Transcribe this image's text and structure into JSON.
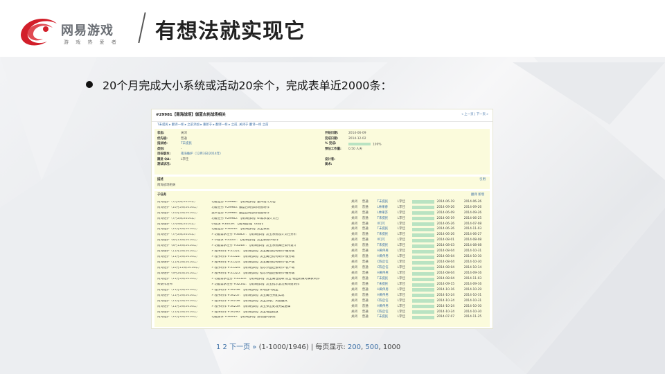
{
  "brand": {
    "name": "网易游戏",
    "sub": "游 戏 热 爱 者",
    "accent": "#d21f2a"
  },
  "slide": {
    "title": "有想法就实现它",
    "bullet": "20个月完成大小系统或活动20余个，完成表单近2000条："
  },
  "screenshot": {
    "title": "#29981【南海战场】伽蓝古刹战场相关",
    "nav": "« 上一页 | 下一页 »",
    "links": "T未提民 ▸ 翻译一样  ▸ 之前添加  ▸ 重新于 ▸ 翻译一样  ▸ 之前, 关闭于 翻译一样 之前",
    "attrs_left": [
      {
        "k": "状态:",
        "v": "关闭"
      },
      {
        "k": "优先级:",
        "v": "普通"
      },
      {
        "k": "指派给:",
        "v": "T未提民"
      },
      {
        "k": "类别:",
        "v": "-"
      },
      {
        "k": "目标版本:",
        "v": "南海维护（12月3日/2014年）"
      },
      {
        "k": "跟进 QA:",
        "v": "L李佳"
      },
      {
        "k": "测试状况:",
        "v": ""
      }
    ],
    "attrs_right": [
      {
        "k": "开始日期:",
        "v": "2014-06-09"
      },
      {
        "k": "完成日期:",
        "v": "2014-12-02"
      },
      {
        "k": "% 完成:",
        "v": "100%"
      },
      {
        "k": "预估工作量:",
        "v": "0.50 人天"
      },
      {
        "k": "",
        "v": ""
      },
      {
        "k": "设计者:",
        "v": ""
      },
      {
        "k": "美术:",
        "v": ""
      }
    ],
    "desc_label": "描述",
    "desc_value": "南海战场相关",
    "quote": "引用",
    "sub_label": "子任务",
    "sub_actions": "翻译  新增",
    "rows": [
      [
        "南海维护（7月2日/2014年）",
        "功能任务 #29982: 【南海战场】整体设计文档",
        "关闭",
        "普通",
        "T未提民",
        "L李佳",
        "2014-06-19",
        "2014-06-26"
      ],
      [
        "南海维护（10月5日/2014年）",
        "功能任务 #29983: 伽蓝古刹战场地图制作",
        "关闭",
        "普通",
        "L林果春",
        "L李佳",
        "2014-09-26",
        "2014-09-26"
      ],
      [
        "南海维护（10月5日/2014年）",
        "美术任务 #29984: 伽蓝古刹战场地图制作",
        "关闭",
        "普通",
        "L林果苏",
        "L李佳",
        "2014-06-09",
        "2014-09-26"
      ],
      [
        "南海维护（7月2日/2014年）",
        "功能任务 #29985: 【南海战场】UI需求设计文档",
        "关闭",
        "普通",
        "T未提民",
        "L李佳",
        "2014-06-19",
        "2014-06-25"
      ],
      [
        "南海维护（7月9日/2014年）",
        "UI需求 #30039: 【南海战场】UI制作",
        "关闭",
        "普通",
        "X叮叮",
        "L李佳",
        "2014-06-26",
        "2014-07-08"
      ],
      [
        "南海维护（12月3日/2014年）",
        "功能任务 #30040: 【南海战场】流宝系统",
        "关闭",
        "普通",
        "T未提民",
        "L李佳",
        "2014-06-26",
        "2014-11-03"
      ],
      [
        "南海维护（7月2日/2014年）",
        "» 功能需求任务 #30857: 【南海战场】流宝系统设计文档分析",
        "关闭",
        "普通",
        "T未提民",
        "L李佳",
        "2014-06-26",
        "2014-06-27"
      ],
      [
        "南海维护（8月13日/2014年）",
        "» UI需求 #31037: 【南海战场】流宝系统UI制作",
        "关闭",
        "普通",
        "X叮叮",
        "L李佳",
        "2014-08-01",
        "2014-08-08"
      ],
      [
        "南海维护（8月13日/2014年）",
        "» 功能需求任务 #31467: 【南海战场】流宝系统属性架构设计",
        "关闭",
        "普通",
        "T未提民",
        "L李佳",
        "2014-08-03",
        "2014-08-08"
      ],
      [
        "南海维护（11月5日/2014年）",
        "» 程序制作 #31521: 【南海战场】流宝属性结构制作-服务端",
        "关闭",
        "普通",
        "H黄伟男",
        "L李佳",
        "2014-08-04",
        "2014-10-31"
      ],
      [
        "南海维护（11月5日/2014年）",
        "» 程序制作 #31522: 【南海战场】流宝属性结构制作-服务端",
        "关闭",
        "普通",
        "H黄伟男",
        "L李佳",
        "2014-08-04",
        "2014-10-30"
      ],
      [
        "南海维护（11月5日/2014年）",
        "» 程序制作 #31523: 【南海战场】流宝属性结构制作-客户端",
        "关闭",
        "普通",
        "C陈启信",
        "L李佳",
        "2014-08-04",
        "2014-10-30"
      ],
      [
        "南海维护（10月15日/2014年）",
        "» 程序制作 #31524: 【南海战场】指示界面连接制作-客户端",
        "关闭",
        "普通",
        "C陈启信",
        "L李佳",
        "2014-08-04",
        "2014-10-14"
      ],
      [
        "南海维护（9月24日/2014年）",
        "» 程序制作 #31525: 【南海战场】指示界面连接制作-服务端",
        "关闭",
        "普通",
        "H黄伟男",
        "L李佳",
        "2014-08-04",
        "2014-09-16"
      ],
      [
        "南海维护（11月5日/2014年）",
        "» 功能需求任务 #31526: 【南海战场】流宝属性提取·流宝·物品附属对属表制作",
        "关闭",
        "普通",
        "T未提民",
        "L李佳",
        "2014-08-04",
        "2014-11-03"
      ],
      [
        "未安排发布",
        "» 功能需求任务 #32542: 【南海战场】流宝指示激活关闭组制作",
        "关闭",
        "普通",
        "T未提民",
        "L李佳",
        "2014-09-15",
        "2014-09-16"
      ],
      [
        "南海维护（11月5日/2014年）",
        "» 程序制作 #34258: 【南海战场】新增战斗类型",
        "关闭",
        "普通",
        "H黄伟男",
        "L李佳",
        "2014-10-16",
        "2014-10-29"
      ],
      [
        "南海维护（11月5日/2014年）",
        "» 程序制作 #34257: 【南海战场】流宝属性分配实现",
        "关闭",
        "普通",
        "H黄伟男",
        "L李佳",
        "2014-10-24",
        "2014-10-31"
      ],
      [
        "南海维护（11月5日/2014年）",
        "» 程序制作 #34258: 【南海战场】流宝分级，奖励器具",
        "关闭",
        "普通",
        "C陈启信",
        "L李佳",
        "2014-10-24",
        "2014-10-31"
      ],
      [
        "南海维护（11月5日/2014年）",
        "» 程序制作 #34259: 【南海战场】流宝弹出处理分类逻辑",
        "关闭",
        "普通",
        "H黄伟男",
        "L李佳",
        "2014-10-24",
        "2014-10-30"
      ],
      [
        "南海维护（11月5日/2014年）",
        "» 程序制作 #34260: 【南海战场】流宝物品投放",
        "关闭",
        "普通",
        "C陈启信",
        "L李佳",
        "2014-10-24",
        "2014-10-30"
      ],
      [
        "南海维护（12月3日/2014年）",
        "功能需求 #30045: 【南海战场】游客副同系统",
        "关闭",
        "普通",
        "T未提民",
        "L李佳",
        "2014-07-07",
        "2014-11-25"
      ]
    ]
  },
  "pager": {
    "pages": "1 2",
    "next": "下一页 »",
    "range": "(1-1000/1946)",
    "sep": " | 每页显示: ",
    "sizes": [
      "200",
      "500",
      "1000"
    ]
  }
}
